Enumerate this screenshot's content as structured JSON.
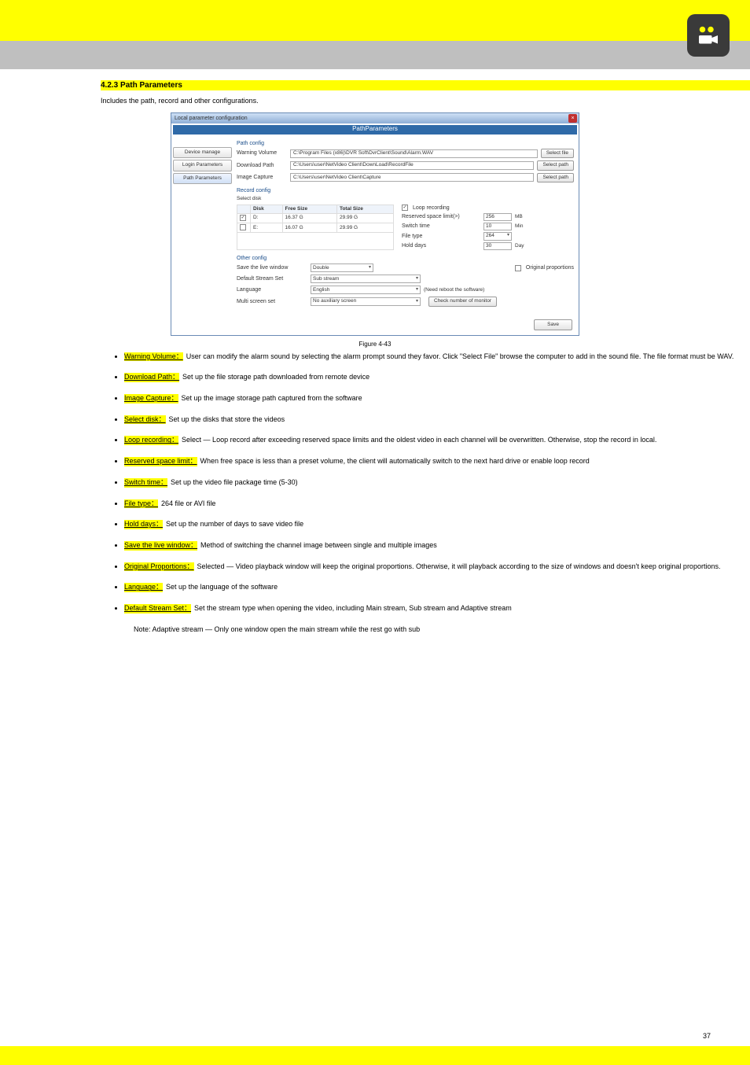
{
  "page_number": "37",
  "section_heading": "4.2.3 Path Parameters",
  "intro_para": "Includes the path, record and other configurations.",
  "figure_caption": "Figure 4-43",
  "dialog": {
    "window_title": "Local parameter configuration",
    "banner": "PathParameters",
    "sidebar": [
      "Device manage",
      "Login Parameters",
      "Path Parameters"
    ],
    "path_config": {
      "title": "Path config",
      "rows": [
        {
          "label": "Warning Volume",
          "value": "C:\\Program Files (x86)\\DVR Soft\\DvrClient\\Sound\\Alarm.WAV",
          "btn": "Select file"
        },
        {
          "label": "Download Path",
          "value": "C:\\Users\\user\\NetVideo Client\\DownLoad\\RecordFile",
          "btn": "Select path"
        },
        {
          "label": "Image Capture",
          "value": "C:\\Users\\user\\NetVideo Client\\Capture",
          "btn": "Select path"
        }
      ]
    },
    "record_config": {
      "title": "Record config",
      "subtitle": "Select disk",
      "cols": [
        "",
        "Disk",
        "Free Size",
        "Total Size"
      ],
      "rows": [
        {
          "checked": true,
          "disk": "D:",
          "free": "16.37 G",
          "total": "29.99 G"
        },
        {
          "checked": false,
          "disk": "E:",
          "free": "16.07 G",
          "total": "29.99 G"
        }
      ],
      "loop_label": "Loop recording",
      "right": [
        {
          "label": "Reserved space limit(>)",
          "value": "256",
          "unit": "MB"
        },
        {
          "label": "Switch time",
          "value": "10",
          "unit": "Min"
        },
        {
          "label": "File type",
          "value": "264",
          "unit": ""
        },
        {
          "label": "Hold days",
          "value": "30",
          "unit": "Day"
        }
      ]
    },
    "other_config": {
      "title": "Other config",
      "rows": [
        {
          "label": "Save the live window",
          "value": "Double"
        },
        {
          "label": "Default Stream Set",
          "value": "Sub stream"
        },
        {
          "label": "Language",
          "value": "English",
          "note": "(Need reboot the software)"
        },
        {
          "label": "Multi screen set",
          "value": "No auxiliary screen"
        }
      ],
      "orig_prop": "Original proportions",
      "check_monitor": "Check number of monitor"
    },
    "save_btn": "Save"
  },
  "bullets": [
    {
      "head": "Warning Volume：",
      "body": "User can modify the alarm sound by selecting the alarm prompt sound they favor. Click \"Select File\" browse the computer to add in the sound file. The file format must be WAV."
    },
    {
      "head": "Download Path：",
      "body": "Set up the file storage path downloaded from remote device"
    },
    {
      "head": "Image Capture：",
      "body": "Set up the image storage path captured from the software"
    },
    {
      "head": "Select disk：",
      "body": "Set up the disks that store the videos"
    },
    {
      "head": "Loop recording：",
      "body": "Select — Loop record after exceeding reserved space limits and the oldest video in each channel will be overwritten. Otherwise, stop the record in local."
    },
    {
      "head": "Reserved space limit：",
      "body": "When free space is less than a preset volume, the client will automatically switch to the next hard drive or enable loop record"
    },
    {
      "head": "Switch time：",
      "body": "Set up the video file package time (5-30)"
    },
    {
      "head": "File type：",
      "body": "264 file or AVI file"
    },
    {
      "head": "Hold days：",
      "body": "Set up the number of days to save video file"
    },
    {
      "head": "Save the live window：",
      "body": "Method of switching the channel image between single and multiple images"
    },
    {
      "head": "Original Proportions：",
      "body": "Selected — Video playback window will keep the original proportions. Otherwise, it will playback according to the size of windows and doesn't keep original proportions."
    },
    {
      "head": "Language：",
      "body": "Set up the language of the software"
    },
    {
      "head": "Default Stream Set：",
      "body": "Set the stream type when opening the video, including Main stream, Sub stream and Adaptive stream"
    }
  ],
  "note_line": "Note: Adaptive stream — Only one window open the main stream while the rest go with sub"
}
